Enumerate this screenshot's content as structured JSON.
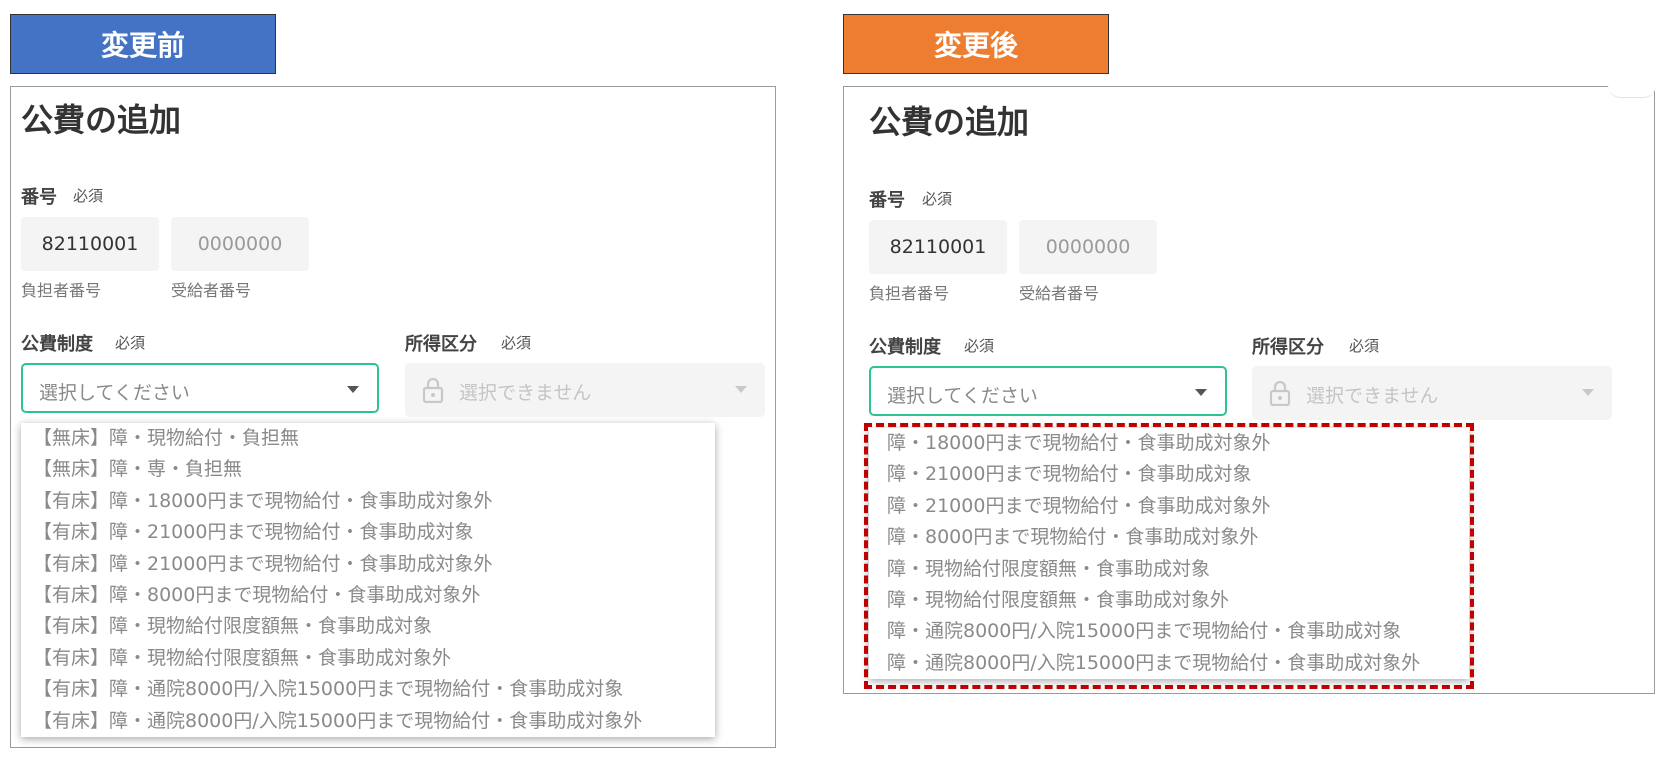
{
  "labels": {
    "before": "変更前",
    "after": "変更後"
  },
  "form": {
    "title": "公費の追加",
    "number_label": "番号",
    "required": "必須",
    "payer_number_value": "82110001",
    "recipient_number_placeholder": "0000000",
    "payer_number_label": "負担者番号",
    "recipient_number_label": "受給者番号",
    "system_label": "公費制度",
    "income_label": "所得区分",
    "select_placeholder": "選択してください",
    "disabled_placeholder": "選択できません"
  },
  "before_options": [
    "【無床】障・現物給付・負担無",
    "【無床】障・専・負担無",
    "【有床】障・18000円まで現物給付・食事助成対象外",
    "【有床】障・21000円まで現物給付・食事助成対象",
    "【有床】障・21000円まで現物給付・食事助成対象外",
    "【有床】障・8000円まで現物給付・食事助成対象外",
    "【有床】障・現物給付限度額無・食事助成対象",
    "【有床】障・現物給付限度額無・食事助成対象外",
    "【有床】障・通院8000円/入院15000円まで現物給付・食事助成対象",
    "【有床】障・通院8000円/入院15000円まで現物給付・食事助成対象外"
  ],
  "after_options": [
    "障・18000円まで現物給付・食事助成対象外",
    "障・21000円まで現物給付・食事助成対象",
    "障・21000円まで現物給付・食事助成対象外",
    "障・8000円まで現物給付・食事助成対象外",
    "障・現物給付限度額無・食事助成対象",
    "障・現物給付限度額無・食事助成対象外",
    "障・通院8000円/入院15000円まで現物給付・食事助成対象",
    "障・通院8000円/入院15000円まで現物給付・食事助成対象外"
  ],
  "colors": {
    "before_label_bg": "#4472c4",
    "after_label_bg": "#ed7d31",
    "select_focus_border": "#2ec48f",
    "highlight_dash": "#c00000"
  }
}
